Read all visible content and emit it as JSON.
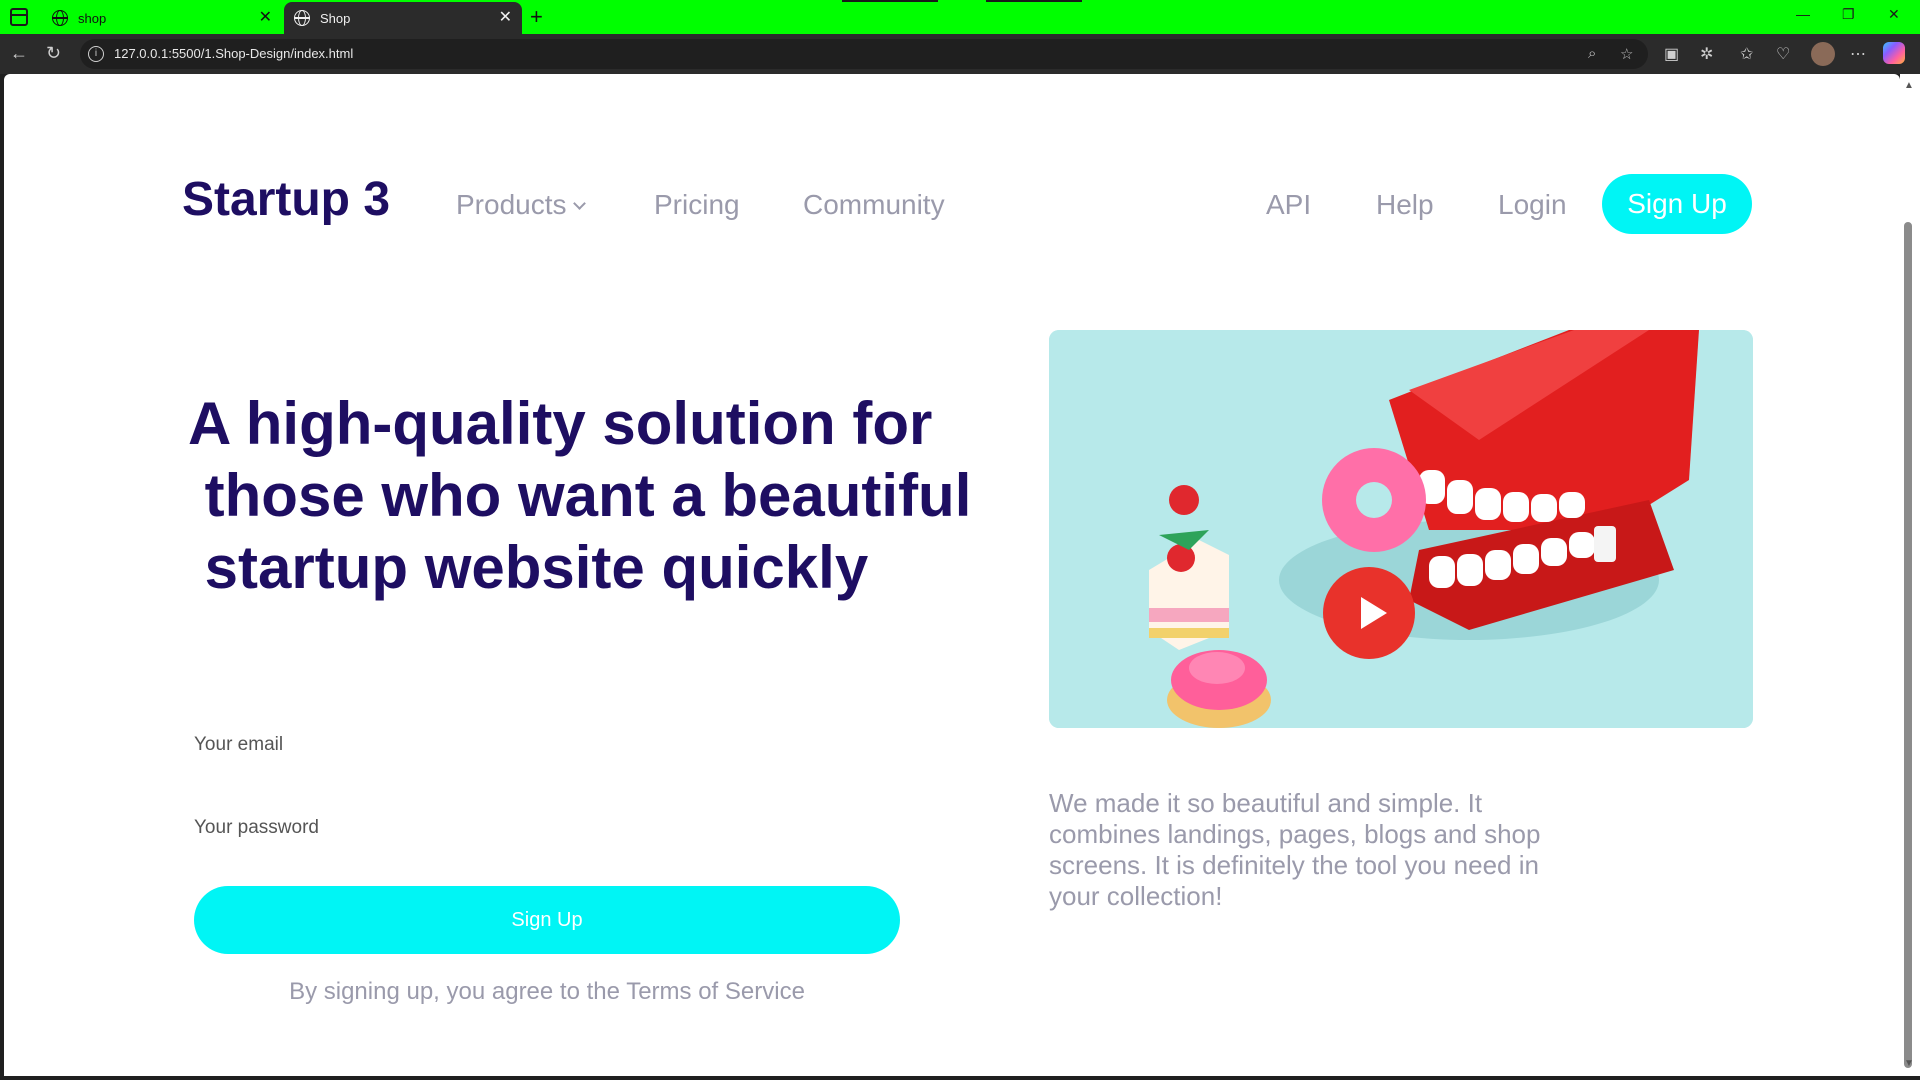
{
  "browser": {
    "tabs": [
      {
        "title": "shop"
      },
      {
        "title": "Shop"
      }
    ],
    "url": "127.0.0.1:5500/1.Shop-Design/index.html"
  },
  "header": {
    "logo": "Startup 3",
    "nav_left": [
      "Products",
      "Pricing",
      "Community"
    ],
    "nav_right": [
      "API",
      "Help",
      "Login"
    ],
    "signup": "Sign Up"
  },
  "hero": {
    "headline": "A high-quality solution for\n those who want a beautiful\n startup website quickly",
    "email_placeholder": "Your email",
    "password_placeholder": "Your password",
    "cta": "Sign Up",
    "terms": "By signing up, you agree to the Terms of Service",
    "description": "We made it so beautiful and simple. It combines landings, pages, blogs and shop screens. It is definitely the tool you need in your collection!"
  },
  "colors": {
    "brand_navy": "#1e0e62",
    "accent_cyan": "#00f5f5",
    "muted_text": "#9a9aab",
    "play_red": "#e8322b",
    "tabbar_green": "#00ff00"
  }
}
